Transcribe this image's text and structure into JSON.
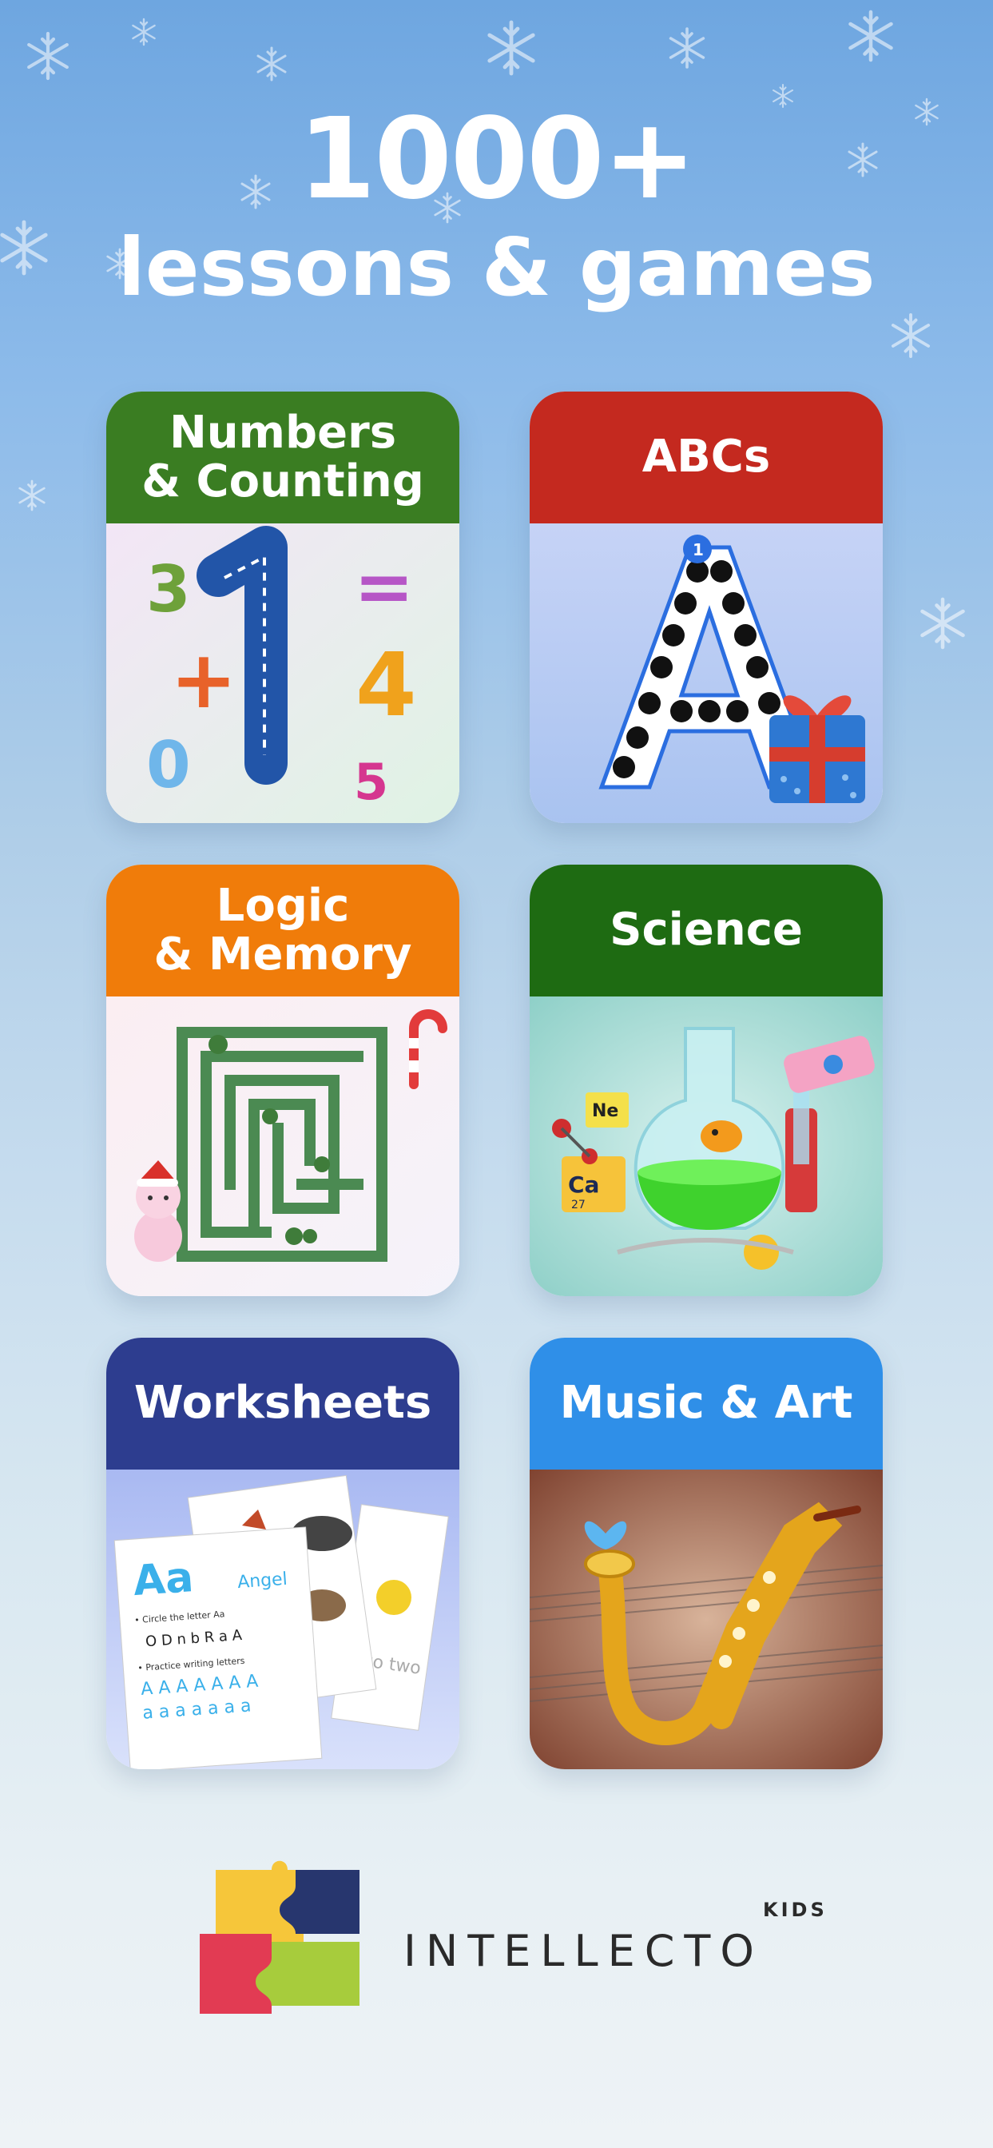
{
  "hero": {
    "headline": "1000+",
    "subline": "lessons & games"
  },
  "cards": [
    {
      "title": "Numbers\n& Counting",
      "color": "#3a7d22"
    },
    {
      "title": "ABCs",
      "color": "#c4291f"
    },
    {
      "title": "Logic\n& Memory",
      "color": "#f07c0a"
    },
    {
      "title": "Science",
      "color": "#1e6b12"
    },
    {
      "title": "Worksheets",
      "color": "#2d3d8f"
    },
    {
      "title": "Music & Art",
      "color": "#2f8fe8"
    }
  ],
  "numbers_art": {
    "digits": [
      "3",
      "1",
      "=",
      "+",
      "4",
      "0",
      "5"
    ]
  },
  "science_art": {
    "badges": [
      "Ne",
      "Ca",
      "27"
    ]
  },
  "worksheet_art": {
    "heading": "Aa",
    "word": "Angel",
    "line1": "• Circle the letter Aa",
    "letters": "O D n b R a A",
    "line2": "• Practice writing letters",
    "trace1": "A A A A A A A",
    "trace2": "a a a a a a a",
    "trace_word": "two two"
  },
  "brand": {
    "name": "INTELLECTO",
    "tag": "KIDS"
  },
  "icons": [
    "snowflake-icon",
    "gift-icon",
    "candy-cane-icon",
    "flask-icon",
    "saxophone-icon",
    "puzzle-logo-icon"
  ]
}
